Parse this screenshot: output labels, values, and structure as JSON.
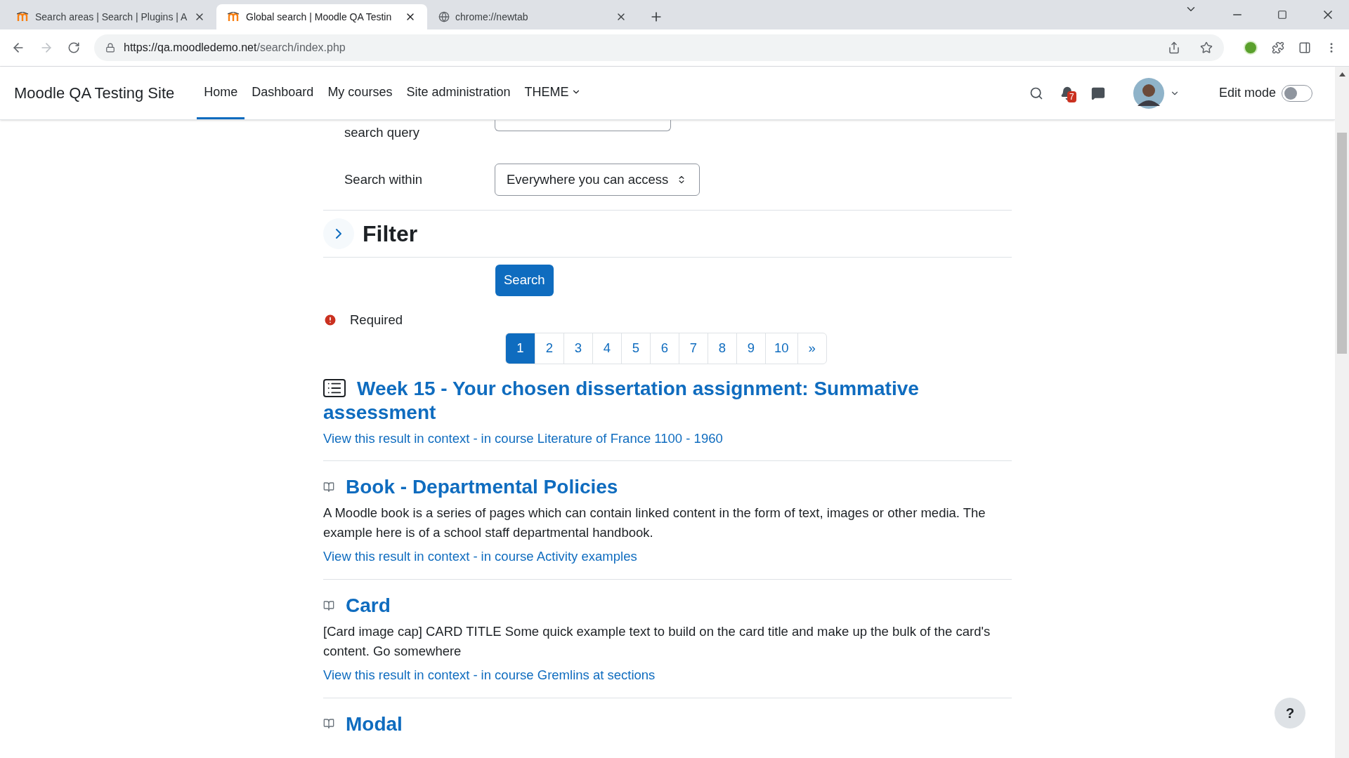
{
  "browser": {
    "tabs": [
      {
        "title": "Search areas | Search | Plugins | A",
        "kind": "moodle",
        "selected": false
      },
      {
        "title": "Global search | Moodle QA Testin",
        "kind": "moodle",
        "selected": true
      },
      {
        "title": "chrome://newtab",
        "kind": "globe",
        "selected": false
      }
    ],
    "url_host": "https://qa.moodledemo.net",
    "url_path": "/search/index.php"
  },
  "navbar": {
    "site_name": "Moodle QA Testing Site",
    "items": [
      {
        "label": "Home",
        "selected": true,
        "dropdown": false
      },
      {
        "label": "Dashboard",
        "selected": false,
        "dropdown": false
      },
      {
        "label": "My courses",
        "selected": false,
        "dropdown": false
      },
      {
        "label": "Site administration",
        "selected": false,
        "dropdown": false
      },
      {
        "label": "THEME",
        "selected": false,
        "dropdown": true
      }
    ],
    "notification_count": "7",
    "edit_mode": {
      "label": "Edit mode",
      "on": false
    }
  },
  "form": {
    "query_label": "search query",
    "search_within": {
      "label": "Search within",
      "value": "Everywhere you can access"
    },
    "filter": {
      "title": "Filter",
      "expanded": false
    },
    "search_button": "Search",
    "required_label": "Required"
  },
  "pagination": [
    {
      "label": "1",
      "selected": true
    },
    {
      "label": "2",
      "selected": false
    },
    {
      "label": "3",
      "selected": false
    },
    {
      "label": "4",
      "selected": false
    },
    {
      "label": "5",
      "selected": false
    },
    {
      "label": "6",
      "selected": false
    },
    {
      "label": "7",
      "selected": false
    },
    {
      "label": "8",
      "selected": false
    },
    {
      "label": "9",
      "selected": false
    },
    {
      "label": "10",
      "selected": false
    },
    {
      "label": "»",
      "selected": false
    }
  ],
  "results": [
    {
      "kind": "assignment",
      "title": "Week 15 - Your chosen dissertation assignment: Summative assessment",
      "link": "View this result in context",
      "separator": "-",
      "course": "in course Literature of France 1100 - 1960"
    },
    {
      "kind": "book",
      "title": "Book - Departmental Policies",
      "description": "A Moodle book is a series of pages which can contain linked content in the form of text, images or other media. The example here is of a school staff departmental handbook.",
      "link": "View this result in context",
      "separator": "-",
      "course": "in course Activity examples"
    },
    {
      "kind": "book",
      "title": "Card",
      "description": "[Card image cap] CARD TITLE Some quick example text to build on the card title and make up the bulk of the card's content. Go somewhere",
      "link": "View this result in context",
      "separator": "-",
      "course": "in course Gremlins at sections"
    },
    {
      "kind": "book",
      "title": "Modal"
    }
  ],
  "help_button": "?"
}
